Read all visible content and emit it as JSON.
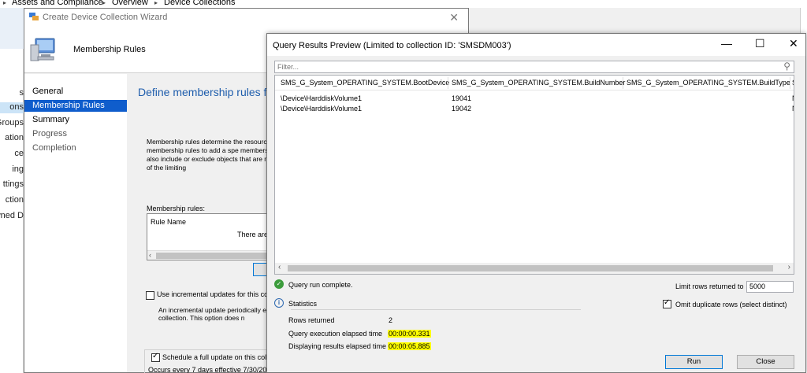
{
  "breadcrumb": {
    "items": [
      "Assets and Compliance",
      "Overview",
      "Device Collections"
    ],
    "sep": "▸"
  },
  "background_nav": {
    "items": [
      "s",
      "ons",
      "Groups",
      "ation",
      "ce",
      "ing",
      "ttings",
      "ction",
      "wned D"
    ]
  },
  "wizard": {
    "title": "Create Device Collection Wizard",
    "close": "✕",
    "page_label": "Membership Rules",
    "steps": [
      {
        "label": "General",
        "state": "normal"
      },
      {
        "label": "Membership Rules",
        "state": "selected"
      },
      {
        "label": "Summary",
        "state": "normal"
      },
      {
        "label": "Progress",
        "state": "dim"
      },
      {
        "label": "Completion",
        "state": "dim"
      }
    ],
    "heading": "Define membership rules for",
    "description": "Membership rules determine the resourc can use membership rules to add a spe membership can also include or exclude objects that are members of the limiting",
    "rules_label": "Membership rules:",
    "rules_header": "Rule Name",
    "rules_empty": "There are",
    "incremental_label": "Use incremental updates for this coll",
    "incremental_desc": "An incremental update periodically e to this collection. This option does n",
    "schedule_label": "Schedule a full update on this coll",
    "occurs": "Occurs every 7 days effective 7/30/20"
  },
  "dialog": {
    "title": "Query Results Preview (Limited to collection ID: 'SMSDM003')",
    "minimize": "—",
    "maximize": "☐",
    "close": "✕",
    "filter_placeholder": "Filter...",
    "columns": [
      "SMS_G_System_OPERATING_SYSTEM.BootDevice",
      "SMS_G_System_OPERATING_SYSTEM.BuildNumber",
      "SMS_G_System_OPERATING_SYSTEM.BuildType",
      "S"
    ],
    "rows": [
      [
        "\\Device\\HarddiskVolume1",
        "19041",
        "",
        "N"
      ],
      [
        "\\Device\\HarddiskVolume1",
        "19042",
        "",
        "N"
      ]
    ],
    "status": "Query run complete.",
    "statistics_label": "Statistics",
    "rows_returned_label": "Rows returned",
    "rows_returned": "2",
    "query_time_label": "Query execution elapsed time",
    "query_time": "00:00:00.331",
    "display_time_label": "Displaying results elapsed time",
    "display_time": "00:00:05.885",
    "limit_label": "Limit rows returned to",
    "limit_value": "5000",
    "omit_label": "Omit duplicate rows (select distinct)",
    "run_label": "Run",
    "close_label": "Close"
  },
  "colors": {
    "accent": "#0f5dcc",
    "heading": "#1e5dac",
    "highlight": "#ffff00"
  }
}
